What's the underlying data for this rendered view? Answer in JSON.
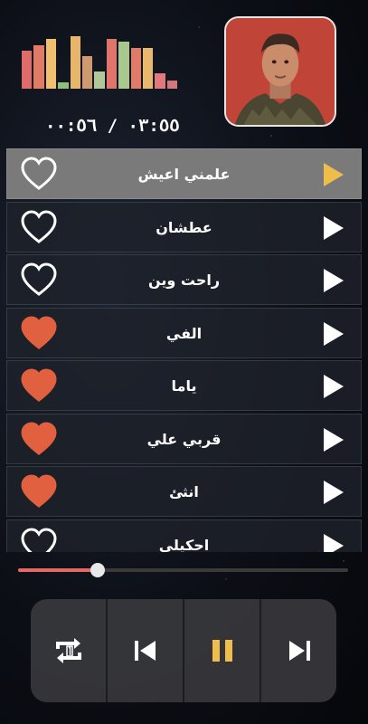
{
  "player": {
    "time_display": "٠٣:٥٥ / ٠٠:٥٦",
    "progress_fraction": 0.24,
    "accent_color": "#e36a64"
  },
  "equalizer": {
    "levels": [
      0.72,
      0.83,
      0.95,
      0.12,
      1.0,
      0.62,
      0.32,
      0.95,
      0.9,
      0.78,
      0.78,
      0.3,
      0.16
    ],
    "colors": [
      "#e06b6b",
      "#e27b66",
      "#f0c070",
      "#8fbf7e",
      "#e8b66a",
      "#cf9a6f",
      "#b0c79a",
      "#e2756b",
      "#a8c88e",
      "#e27a6a",
      "#e8b86d",
      "#e0787c",
      "#d1787c"
    ]
  },
  "cover": {
    "icon": "artist-photo"
  },
  "songs": [
    {
      "title": "علمني اعيش",
      "liked": false,
      "active": true
    },
    {
      "title": "عطشان",
      "liked": false,
      "active": false
    },
    {
      "title": "راحت وين",
      "liked": false,
      "active": false
    },
    {
      "title": "الفي",
      "liked": true,
      "active": false
    },
    {
      "title": "ياما",
      "liked": true,
      "active": false
    },
    {
      "title": "قربي علي",
      "liked": true,
      "active": false
    },
    {
      "title": "انثئ",
      "liked": true,
      "active": false
    },
    {
      "title": "احكيلي",
      "liked": false,
      "active": false
    }
  ],
  "colors": {
    "heart_filled": "#e0603f",
    "play_active": "#efbd4c",
    "play_default": "#ffffff",
    "pause": "#efbd4c"
  },
  "controls": [
    {
      "name": "repeat-one",
      "icon": "repeat-one-icon"
    },
    {
      "name": "previous",
      "icon": "skip-previous-icon"
    },
    {
      "name": "pause",
      "icon": "pause-icon"
    },
    {
      "name": "next",
      "icon": "skip-next-icon"
    }
  ]
}
